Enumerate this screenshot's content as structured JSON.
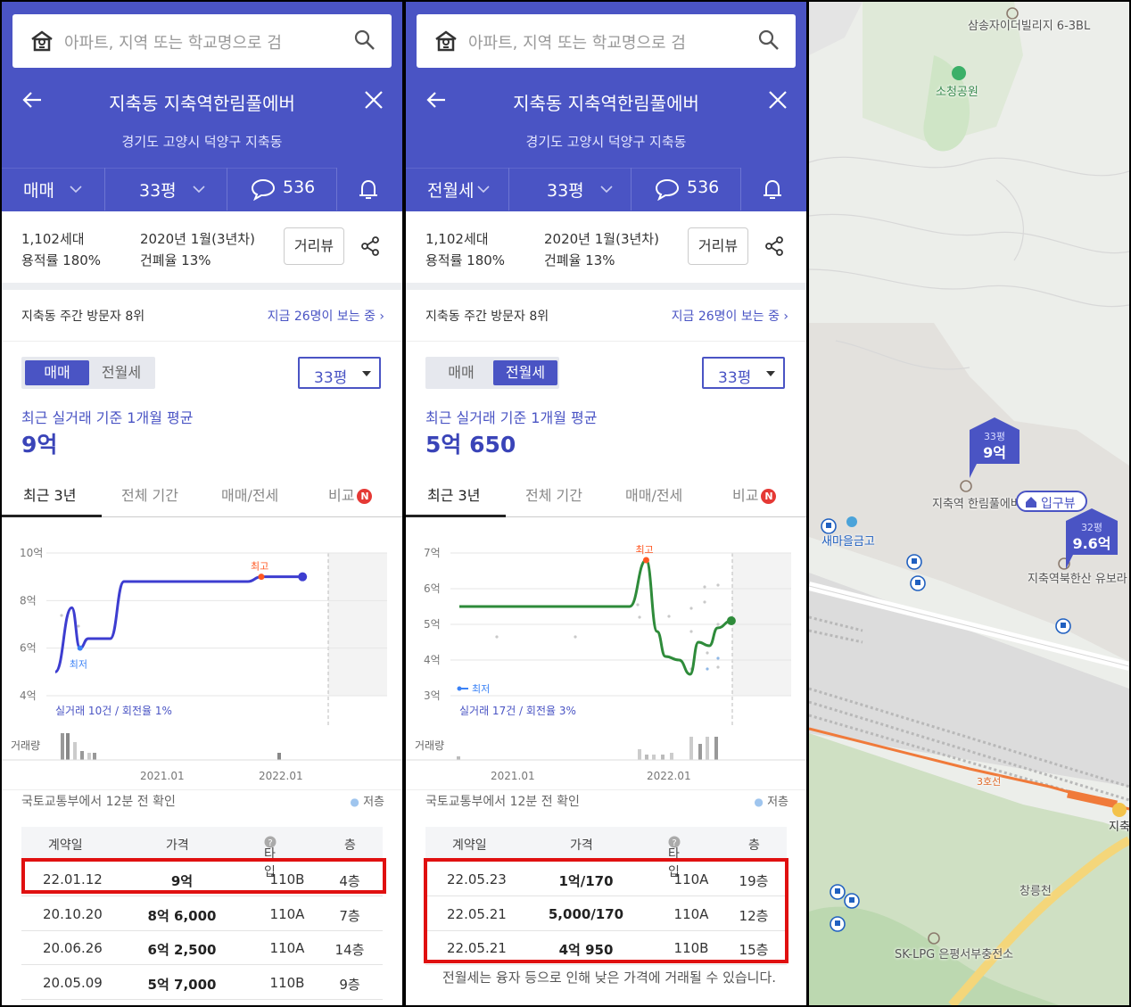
{
  "search": {
    "placeholder": "아파트, 지역 또는 학교명으로 검"
  },
  "complex": {
    "title": "지축동 지축역한림풀에버",
    "address": "경기도 고양시 덕양구 지축동",
    "households": "1,102세대",
    "built": "2020년 1월(3년차)",
    "floor_area_ratio": "용적률 180%",
    "coverage_ratio": "건폐율 13%",
    "distance_view": "거리뷰",
    "visitors_rank": "지축동 주간 방문자 8위",
    "viewing_now": "지금 26명이 보는 중 ›"
  },
  "tabs": [
    "최근 3년",
    "전체 기간",
    "매매/전세",
    "비교"
  ],
  "new_badge": "N",
  "colors": {
    "header": "#4a54c4",
    "sale_line": "#3d3dd0",
    "rent_line": "#2e8b3a",
    "highlight": "#e01010"
  },
  "panels": [
    {
      "deal": "매매",
      "size": "33평",
      "comments": "536",
      "seg": [
        "매매",
        "전월세"
      ],
      "seg_active": 0,
      "avg_label": "최근 실거래 기준 1개월 평균",
      "avg_value": "9억",
      "trade_summary": "실거래 10건 / 회전율 1%",
      "source": "국토교통부에서 12분 전 확인",
      "low_label": "저층",
      "chart_data": {
        "type": "line",
        "y_ticks": [
          "10억",
          "8억",
          "6억",
          "4억"
        ],
        "ylim": [
          4,
          10
        ],
        "x_ticks": [
          "2021.01",
          "2022.01"
        ],
        "volume_label": "거래량",
        "max_label": "최고",
        "min_label": "최저",
        "series": [
          {
            "points": [
              [
                0,
                5
              ],
              [
                6,
                7.7
              ],
              [
                9,
                6
              ],
              [
                12,
                6.4
              ],
              [
                20,
                6.4
              ],
              [
                25,
                8.8
              ],
              [
                70,
                8.8
              ],
              [
                75,
                9
              ],
              [
                90,
                9
              ]
            ]
          }
        ]
      },
      "table": {
        "headers": [
          "계약일",
          "가격",
          "타입",
          "층"
        ],
        "rows": [
          [
            "22.01.12",
            "9억",
            "110B",
            "4층"
          ],
          [
            "20.10.20",
            "8억 6,000",
            "110A",
            "7층"
          ],
          [
            "20.06.26",
            "6억 2,500",
            "110A",
            "14층"
          ],
          [
            "20.05.09",
            "5억 7,000",
            "110B",
            "9층"
          ]
        ]
      }
    },
    {
      "deal": "전월세",
      "size": "33평",
      "comments": "536",
      "seg": [
        "매매",
        "전월세"
      ],
      "seg_active": 1,
      "avg_label": "최근 실거래 기준 1개월 평균",
      "avg_value": "5억 650",
      "trade_summary": "실거래 17건 / 회전율 3%",
      "source": "국토교통부에서 12분 전 확인",
      "low_label": "저층",
      "legend_label": "최저",
      "chart_data": {
        "type": "line",
        "y_ticks": [
          "7억",
          "6억",
          "5억",
          "4억",
          "3억"
        ],
        "ylim": [
          3,
          7
        ],
        "x_ticks": [
          "2021.01",
          "2022.01"
        ],
        "volume_label": "거래량",
        "max_label": "최고",
        "series": [
          {
            "points": [
              [
                0,
                5.5
              ],
              [
                55,
                5.5
              ],
              [
                62,
                5.5
              ],
              [
                68,
                6.8
              ],
              [
                72,
                4.8
              ],
              [
                75,
                4.1
              ],
              [
                80,
                4.0
              ],
              [
                84,
                3.6
              ],
              [
                87,
                4.5
              ],
              [
                91,
                4.4
              ],
              [
                94,
                4.9
              ],
              [
                99,
                5.1
              ]
            ]
          }
        ]
      },
      "table": {
        "headers": [
          "계약일",
          "가격",
          "타입",
          "층"
        ],
        "rows": [
          [
            "22.05.23",
            "1억/170",
            "110A",
            "19층"
          ],
          [
            "22.05.21",
            "5,000/170",
            "110A",
            "12층"
          ],
          [
            "22.05.21",
            "4억 950",
            "110B",
            "15층"
          ]
        ]
      },
      "note": "전월세는 융자 등으로 인해 낮은 가격에 거래될 수 있습니다."
    }
  ],
  "map": {
    "labels": [
      "삼송자이더빌리지 6-3BL",
      "소청공원",
      "지축역 한림풀에버",
      "새마을금고",
      "지축역북한산 유보라",
      "창릉천",
      "SK-LPG 은평서부충전소",
      "3호선",
      "지축",
      "입구뷰"
    ],
    "markers": [
      {
        "size": "33평",
        "price": "9억"
      },
      {
        "size": "32평",
        "price": "9.6억"
      }
    ]
  }
}
